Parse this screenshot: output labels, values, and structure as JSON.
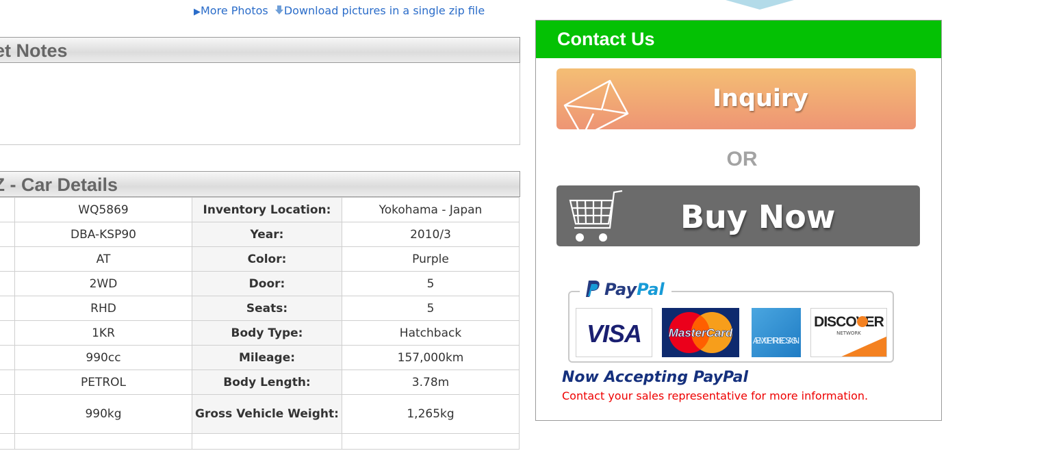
{
  "top_links": {
    "more_photos": "More Photos",
    "download": "Download pictures in a single zip file"
  },
  "notes": {
    "title": "Sheet Notes",
    "visible_title": "eet Notes"
  },
  "details": {
    "visible_title": "TZ - Car Details",
    "rows": [
      {
        "value": "WQ5869",
        "label": "Inventory Location:",
        "value2": "Yokohama - Japan"
      },
      {
        "value": "DBA-KSP90",
        "label": "Year:",
        "value2": "2010/3"
      },
      {
        "value": "AT",
        "label": "Color:",
        "value2": "Purple"
      },
      {
        "value": "2WD",
        "label": "Door:",
        "value2": "5"
      },
      {
        "value": "RHD",
        "label": "Seats:",
        "value2": "5"
      },
      {
        "value": "1KR",
        "label": "Body Type:",
        "value2": "Hatchback"
      },
      {
        "value": "990cc",
        "label": "Mileage:",
        "value2": "157,000km"
      },
      {
        "value": "PETROL",
        "label": "Body Length:",
        "value2": "3.78m"
      },
      {
        "value": "990kg",
        "label": "Gross Vehicle Weight:",
        "value2": "1,265kg"
      }
    ]
  },
  "contact": {
    "title": "Contact Us",
    "inquiry_label": "Inquiry",
    "or_label": "OR",
    "buy_label": "Buy Now",
    "paypal_word1": "Pay",
    "paypal_word2": "Pal",
    "cards": {
      "visa": "VISA",
      "mastercard": "MasterCard",
      "amex_line1": "AMERICAN",
      "amex_line2": "EXPRESS",
      "discover": "DISCOVER",
      "discover_sub": "NETWORK"
    },
    "accepting": "Now Accepting PayPal",
    "accepting_sub": "Contact your sales representative for more information."
  },
  "colors": {
    "link": "#2a6cc9",
    "contact_header": "#04c104",
    "inquiry_top": "#f4be74",
    "inquiry_bottom": "#ee9574",
    "buy_button": "#6b6b6b",
    "paypal_dark": "#253b80",
    "paypal_light": "#179bd7",
    "notice_red": "#e00000"
  }
}
